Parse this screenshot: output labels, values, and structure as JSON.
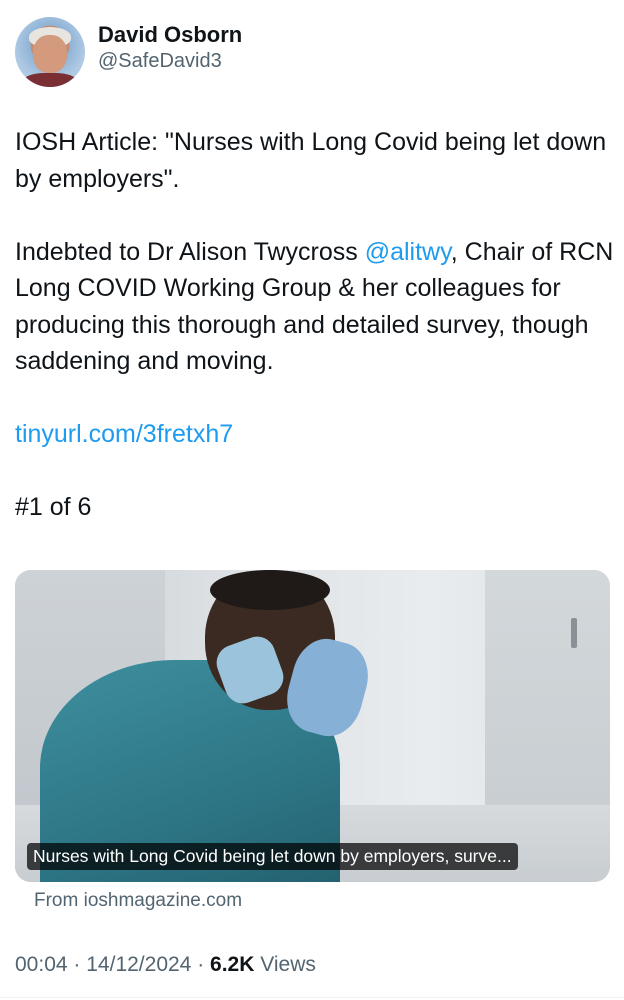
{
  "author": {
    "display_name": "David Osborn",
    "handle": "@SafeDavid3",
    "avatar_icon": "profile-photo"
  },
  "tweet": {
    "para1": "IOSH Article: \"Nurses with Long Covid being let down by employers\".",
    "para2_before": "Indebted to Dr Alison Twycross ",
    "para2_mention": "@alitwy",
    "para2_after": ", Chair of RCN Long COVID Working Group & her colleagues for producing this thorough and detailed survey, though saddening and moving.",
    "link": "tinyurl.com/3fretxh7",
    "thread_count": "#1 of 6"
  },
  "card": {
    "caption": "Nurses with Long Covid being let down by employers, surve...",
    "source": "From ioshmagazine.com"
  },
  "meta": {
    "time": "00:04",
    "separator": "·",
    "date": "14/12/2024",
    "views_count": "6.2K",
    "views_label": "Views"
  },
  "colors": {
    "link": "#1d9bf0",
    "secondary_text": "#536471",
    "primary_text": "#0f1419"
  }
}
